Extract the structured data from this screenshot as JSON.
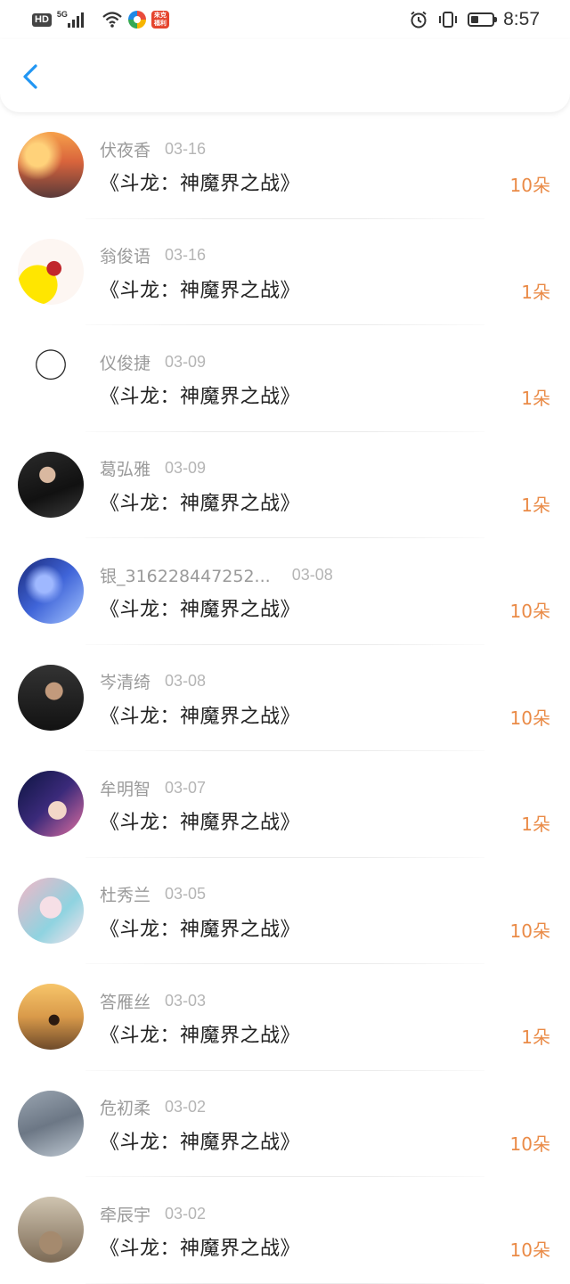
{
  "status_bar": {
    "hd": "HD",
    "network": "5G",
    "app_badge": "来克 福利",
    "time": "8:57",
    "battery_level": 0.35
  },
  "header": {
    "back_icon": "chevron-left-icon",
    "accent_color": "#2196f3"
  },
  "colors": {
    "amount": "#ea8b47",
    "name": "#9a9a9a",
    "title": "#222222"
  },
  "rows": [
    {
      "name": "伏夜香",
      "date": "03-16",
      "title": "《斗龙：神魔界之战》",
      "amount": "10朵",
      "avatar": "couple-sunset"
    },
    {
      "name": "翁俊语",
      "date": "03-16",
      "title": "《斗龙：神魔界之战》",
      "amount": "1朵",
      "avatar": "lips-cartoon"
    },
    {
      "name": "仪俊捷",
      "date": "03-09",
      "title": "《斗龙：神魔界之战》",
      "amount": "1朵",
      "avatar": "meme-face"
    },
    {
      "name": "葛弘雅",
      "date": "03-09",
      "title": "《斗龙：神魔界之战》",
      "amount": "1朵",
      "avatar": "dark-portrait"
    },
    {
      "name": "银_316228447252...",
      "date": "03-08",
      "title": "《斗龙：神魔界之战》",
      "amount": "10朵",
      "avatar": "blue-anime"
    },
    {
      "name": "岑清绮",
      "date": "03-08",
      "title": "《斗龙：神魔界之战》",
      "amount": "10朵",
      "avatar": "man-portrait"
    },
    {
      "name": "牟明智",
      "date": "03-07",
      "title": "《斗龙：神魔界之战》",
      "amount": "1朵",
      "avatar": "anime-galaxy"
    },
    {
      "name": "杜秀兰",
      "date": "03-05",
      "title": "《斗龙：神魔界之战》",
      "amount": "10朵",
      "avatar": "pink-anime"
    },
    {
      "name": "答雁丝",
      "date": "03-03",
      "title": "《斗龙：神魔界之战》",
      "amount": "1朵",
      "avatar": "beach-couple"
    },
    {
      "name": "危初柔",
      "date": "03-02",
      "title": "《斗龙：神魔界之战》",
      "amount": "10朵",
      "avatar": "hello-august"
    },
    {
      "name": "牵辰宇",
      "date": "03-02",
      "title": "《斗龙：神魔界之战》",
      "amount": "10朵",
      "avatar": "sneakers"
    }
  ]
}
